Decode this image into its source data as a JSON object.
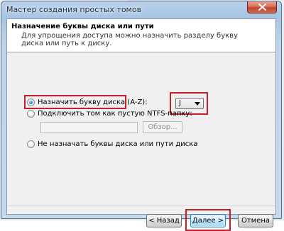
{
  "window": {
    "title": "Мастер создания простых томов"
  },
  "header": {
    "title": "Назначение буквы диска или пути",
    "description": "Для упрощения доступа можно назначить разделу букву диска или путь к диску."
  },
  "options": {
    "assign_letter": {
      "label": "Назначить букву диска (A-Z):",
      "selected": true
    },
    "mount_folder": {
      "label": "Подключить том как пустую NTFS-папку:",
      "selected": false
    },
    "no_letter": {
      "label": "Не назначать буквы диска или пути диска",
      "selected": false
    }
  },
  "drive_letter": {
    "value": "J"
  },
  "folder_path": {
    "value": ""
  },
  "buttons": {
    "browse": "Обзор...",
    "back": "< Назад",
    "next": "Далее >",
    "cancel": "Отмена"
  },
  "colors": {
    "highlight_frame": "#c8202a",
    "title_bar": "#a9c5e3",
    "close_button": "#c0452c"
  },
  "icons": {
    "close": "close-icon",
    "dropdown": "chevron-down-icon"
  }
}
